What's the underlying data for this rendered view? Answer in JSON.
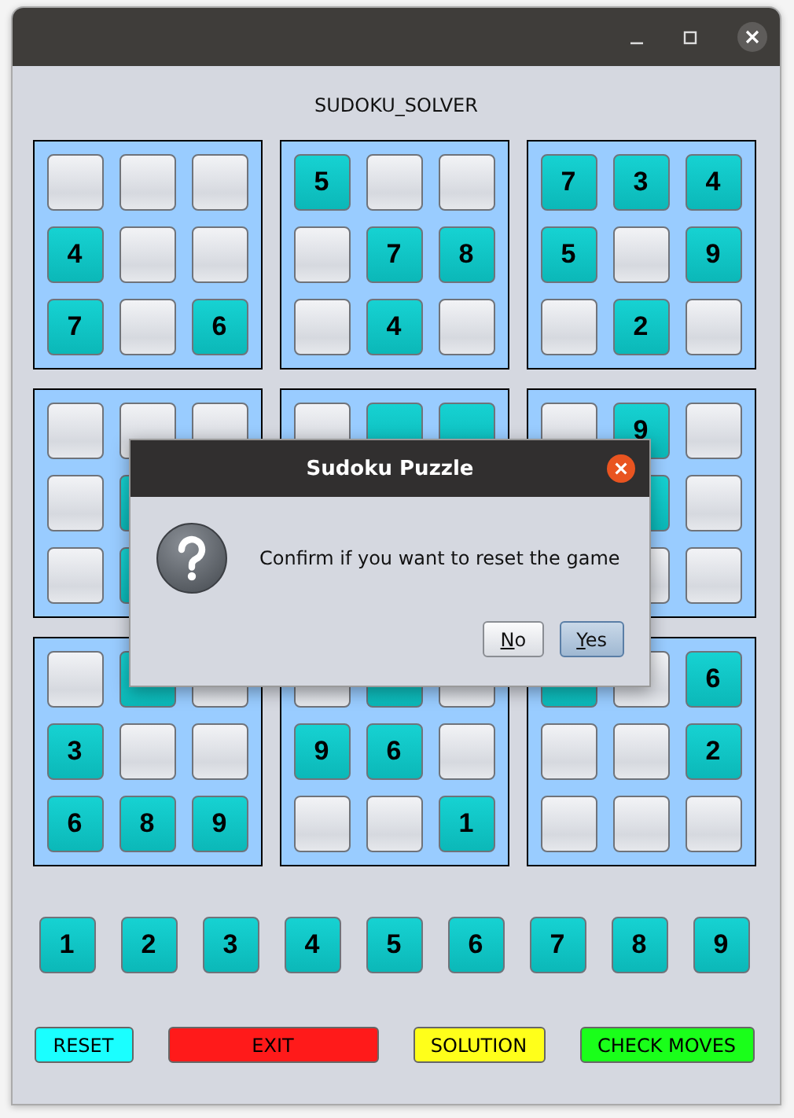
{
  "window": {
    "title": "SUDOKU_SOLVER"
  },
  "boxes": [
    {
      "cells": [
        {
          "filled": false
        },
        {
          "filled": false
        },
        {
          "filled": false
        },
        {
          "filled": true,
          "value": "4"
        },
        {
          "filled": false
        },
        {
          "filled": false
        },
        {
          "filled": true,
          "value": "7"
        },
        {
          "filled": false
        },
        {
          "filled": true,
          "value": "6"
        }
      ]
    },
    {
      "cells": [
        {
          "filled": true,
          "value": "5"
        },
        {
          "filled": false
        },
        {
          "filled": false
        },
        {
          "filled": false
        },
        {
          "filled": true,
          "value": "7"
        },
        {
          "filled": true,
          "value": "8"
        },
        {
          "filled": false
        },
        {
          "filled": true,
          "value": "4"
        },
        {
          "filled": false
        }
      ]
    },
    {
      "cells": [
        {
          "filled": true,
          "value": "7"
        },
        {
          "filled": true,
          "value": "3"
        },
        {
          "filled": true,
          "value": "4"
        },
        {
          "filled": true,
          "value": "5"
        },
        {
          "filled": false
        },
        {
          "filled": true,
          "value": "9"
        },
        {
          "filled": false
        },
        {
          "filled": true,
          "value": "2"
        },
        {
          "filled": false
        }
      ]
    },
    {
      "cells": [
        {
          "filled": false
        },
        {
          "filled": false
        },
        {
          "filled": false
        },
        {
          "filled": false
        },
        {
          "filled": true
        },
        null,
        {
          "filled": false
        },
        {
          "filled": true
        },
        null
      ]
    },
    {
      "cells": [
        {
          "filled": false
        },
        {
          "filled": true
        },
        {
          "filled": true
        },
        null,
        null,
        null,
        null,
        null,
        null
      ]
    },
    {
      "cells": [
        {
          "filled": false
        },
        {
          "filled": true,
          "value": "9"
        },
        {
          "filled": false
        },
        null,
        {
          "filled": true
        },
        {
          "filled": false
        },
        null,
        {
          "filled": false
        },
        {
          "filled": false
        }
      ]
    },
    {
      "cells": [
        {
          "filled": false
        },
        {
          "filled": true
        },
        {
          "filled": false
        },
        {
          "filled": true,
          "value": "3"
        },
        {
          "filled": false
        },
        {
          "filled": false
        },
        {
          "filled": true,
          "value": "6"
        },
        {
          "filled": true,
          "value": "8"
        },
        {
          "filled": true,
          "value": "9"
        }
      ]
    },
    {
      "cells": [
        {
          "filled": false
        },
        {
          "filled": true
        },
        {
          "filled": false
        },
        {
          "filled": true,
          "value": "9"
        },
        {
          "filled": true,
          "value": "6"
        },
        {
          "filled": false
        },
        {
          "filled": false
        },
        {
          "filled": false
        },
        {
          "filled": true,
          "value": "1"
        }
      ]
    },
    {
      "cells": [
        {
          "filled": true
        },
        {
          "filled": false
        },
        {
          "filled": true,
          "value": "6"
        },
        {
          "filled": false
        },
        {
          "filled": false
        },
        {
          "filled": true,
          "value": "2"
        },
        {
          "filled": false
        },
        {
          "filled": false
        },
        {
          "filled": false
        }
      ]
    }
  ],
  "number_buttons": [
    "1",
    "2",
    "3",
    "4",
    "5",
    "6",
    "7",
    "8",
    "9"
  ],
  "actions": [
    {
      "label": "RESET",
      "color": "#1affff"
    },
    {
      "label": "EXIT",
      "color": "#ff1a1a"
    },
    {
      "label": "SOLUTION",
      "color": "#ffff1a"
    },
    {
      "label": "CHECK MOVES",
      "color": "#1aff1a"
    }
  ],
  "dialog": {
    "title": "Sudoku Puzzle",
    "message": "Confirm if you want to reset the game",
    "buttons": [
      {
        "label": "No",
        "underline_first": true,
        "selected": false
      },
      {
        "label": "Yes",
        "underline_first": true,
        "selected": true
      }
    ]
  }
}
